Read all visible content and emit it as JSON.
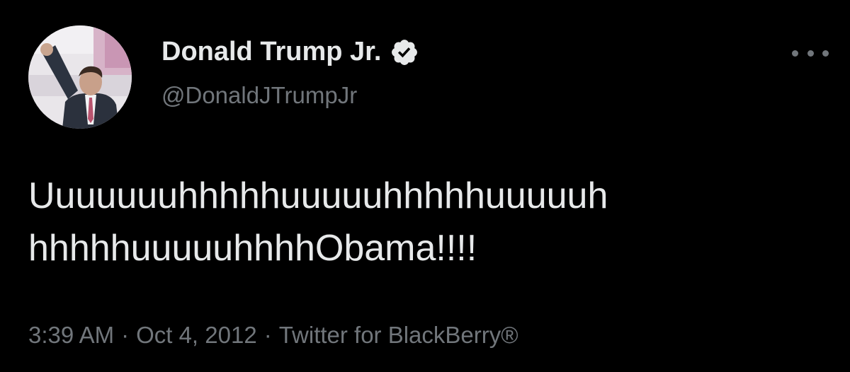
{
  "author": {
    "display_name": "Donald Trump Jr.",
    "handle": "@DonaldJTrumpJr",
    "verified_icon": "verified-badge-icon",
    "verified_color": "#e7e9ea"
  },
  "menu": {
    "icon": "more-options-icon"
  },
  "tweet": {
    "text_lines": [
      "Uuuuuuuhhhhhuuuuuhhhhhuuuuuh",
      "hhhhhuuuuuhhhhObama!!!!"
    ]
  },
  "meta": {
    "time": "3:39 AM",
    "date": "Oct 4, 2012",
    "separator": "·",
    "source": "Twitter for BlackBerry®"
  },
  "colors": {
    "background": "#000000",
    "primary_text": "#e7e9ea",
    "secondary_text": "#71767b"
  }
}
